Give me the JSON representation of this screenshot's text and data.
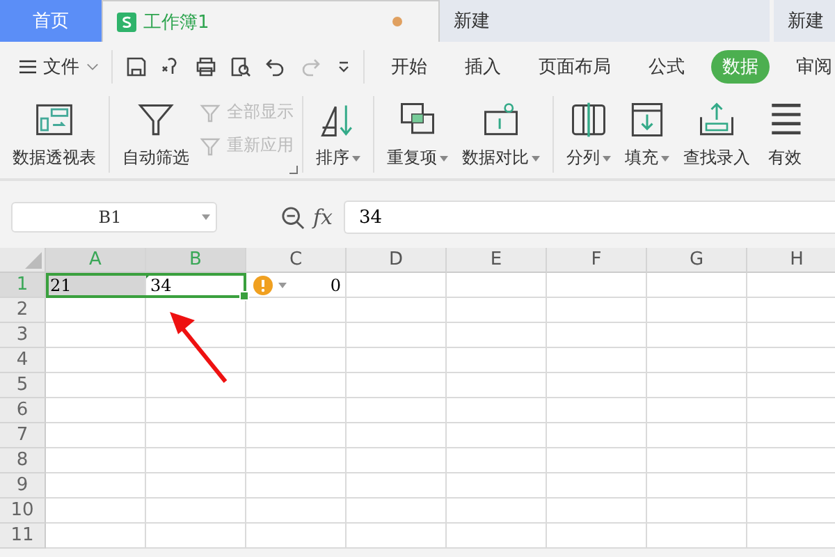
{
  "tabs": [
    {
      "kind": "home",
      "label": "首页",
      "selected": false
    },
    {
      "kind": "doc",
      "label": "工作簿1",
      "selected": true,
      "modified": true
    },
    {
      "kind": "new",
      "label": "新建",
      "selected": false
    },
    {
      "kind": "new",
      "label": "新建",
      "selected": false
    }
  ],
  "menu": {
    "file": "文件",
    "quick_tools": [
      {
        "disabled": false
      },
      {
        "disabled": false
      },
      {
        "disabled": false
      },
      {
        "disabled": false
      },
      {
        "disabled": false
      },
      {
        "disabled": true
      }
    ],
    "tabs": [
      {
        "label": "开始",
        "selected": false
      },
      {
        "label": "插入",
        "selected": false
      },
      {
        "label": "页面布局",
        "selected": false
      },
      {
        "label": "公式",
        "selected": false
      },
      {
        "label": "数据",
        "selected": true
      },
      {
        "label": "审阅",
        "selected": false
      }
    ]
  },
  "ribbon": {
    "groups": [
      {
        "items": [
          {
            "kind": "large",
            "label": "数据透视表",
            "dropdown": false,
            "disabled": false
          }
        ]
      },
      {
        "launcher": true,
        "items": [
          {
            "kind": "large",
            "label": "自动筛选",
            "dropdown": false,
            "disabled": false
          },
          {
            "kind": "small",
            "label": "全部显示",
            "dropdown": false,
            "disabled": true
          },
          {
            "kind": "small",
            "label": "重新应用",
            "dropdown": false,
            "disabled": true
          }
        ]
      },
      {
        "items": [
          {
            "kind": "large",
            "label": "排序",
            "dropdown": true,
            "disabled": false
          }
        ]
      },
      {
        "items": [
          {
            "kind": "large",
            "label": "重复项",
            "dropdown": true,
            "disabled": false
          },
          {
            "kind": "large",
            "label": "数据对比",
            "dropdown": true,
            "disabled": false
          }
        ]
      },
      {
        "items": [
          {
            "kind": "large",
            "label": "分列",
            "dropdown": true,
            "disabled": false
          },
          {
            "kind": "large",
            "label": "填充",
            "dropdown": true,
            "disabled": false
          },
          {
            "kind": "large",
            "label": "查找录入",
            "dropdown": false,
            "disabled": false
          },
          {
            "kind": "large",
            "label": "有效",
            "dropdown": false,
            "disabled": false
          }
        ]
      }
    ]
  },
  "formula_bar": {
    "name_box": "B1",
    "fx": "fx",
    "value": "34"
  },
  "sheet": {
    "columns": [
      {
        "label": "A",
        "selected": true
      },
      {
        "label": "B",
        "selected": true
      },
      {
        "label": "C",
        "selected": false
      },
      {
        "label": "D",
        "selected": false
      },
      {
        "label": "E",
        "selected": false
      },
      {
        "label": "F",
        "selected": false
      },
      {
        "label": "G",
        "selected": false
      },
      {
        "label": "H",
        "selected": false
      }
    ],
    "rows": [
      {
        "label": "1",
        "selected": true,
        "cells": [
          {
            "kind": "text",
            "value": "21",
            "selected": true,
            "active": false,
            "warning": false
          },
          {
            "kind": "text",
            "value": "34",
            "selected": true,
            "active": true,
            "warning": false
          },
          {
            "kind": "number",
            "value": "0",
            "selected": false,
            "active": false,
            "warning": true
          }
        ]
      },
      {
        "label": "2",
        "selected": false,
        "cells": []
      },
      {
        "label": "3",
        "selected": false,
        "cells": []
      },
      {
        "label": "4",
        "selected": false,
        "cells": []
      },
      {
        "label": "5",
        "selected": false,
        "cells": []
      },
      {
        "label": "6",
        "selected": false,
        "cells": []
      },
      {
        "label": "7",
        "selected": false,
        "cells": []
      },
      {
        "label": "8",
        "selected": false,
        "cells": []
      },
      {
        "label": "9",
        "selected": false,
        "cells": []
      },
      {
        "label": "10",
        "selected": false,
        "cells": []
      },
      {
        "label": "11",
        "selected": false,
        "cells": []
      }
    ]
  }
}
